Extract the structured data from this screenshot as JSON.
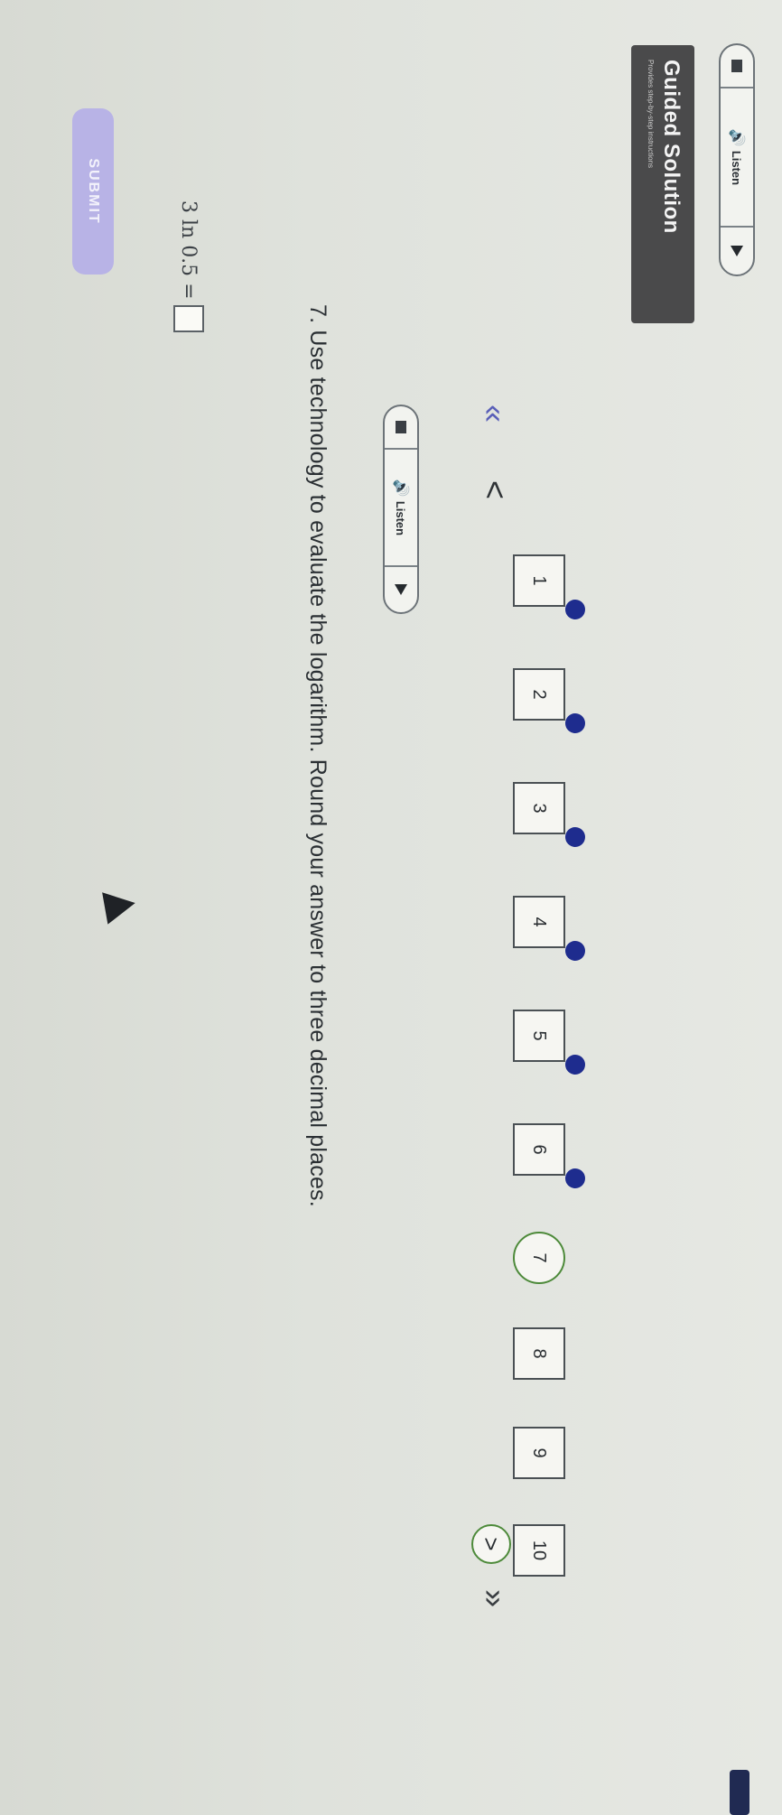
{
  "top_listen": {
    "label": "Listen",
    "speaker_icon": "speaker-icon",
    "stop_icon": "stop-icon",
    "play_icon": "play-icon"
  },
  "guided": {
    "title": "Guided Solution",
    "subtitle": "Provides step-by-step instructions"
  },
  "submit": {
    "label": "SUBMIT"
  },
  "question_listen": {
    "label": "Listen"
  },
  "nav": {
    "first_glyph": "«",
    "prev_glyph": "<",
    "next_glyph": ">",
    "last_glyph": "»",
    "questions": [
      {
        "label": "1",
        "answered": true
      },
      {
        "label": "2",
        "answered": true
      },
      {
        "label": "3",
        "answered": true
      },
      {
        "label": "4",
        "answered": true
      },
      {
        "label": "5",
        "answered": true
      },
      {
        "label": "6",
        "answered": true
      },
      {
        "label": "7",
        "answered": false,
        "current": true
      },
      {
        "label": "8",
        "answered": false
      },
      {
        "label": "9",
        "answered": false
      },
      {
        "label": "10",
        "answered": false
      }
    ]
  },
  "question": {
    "text": "7. Use technology to evaluate the logarithm. Round your answer to three decimal places.",
    "expression": "3 ln 0.5 =",
    "answer_value": ""
  },
  "colors": {
    "answered_dot": "#1e2c8e",
    "current_ring": "#4d8a3a",
    "submit_bg": "#b8b3e6",
    "guided_bg": "#4a4a4b"
  }
}
